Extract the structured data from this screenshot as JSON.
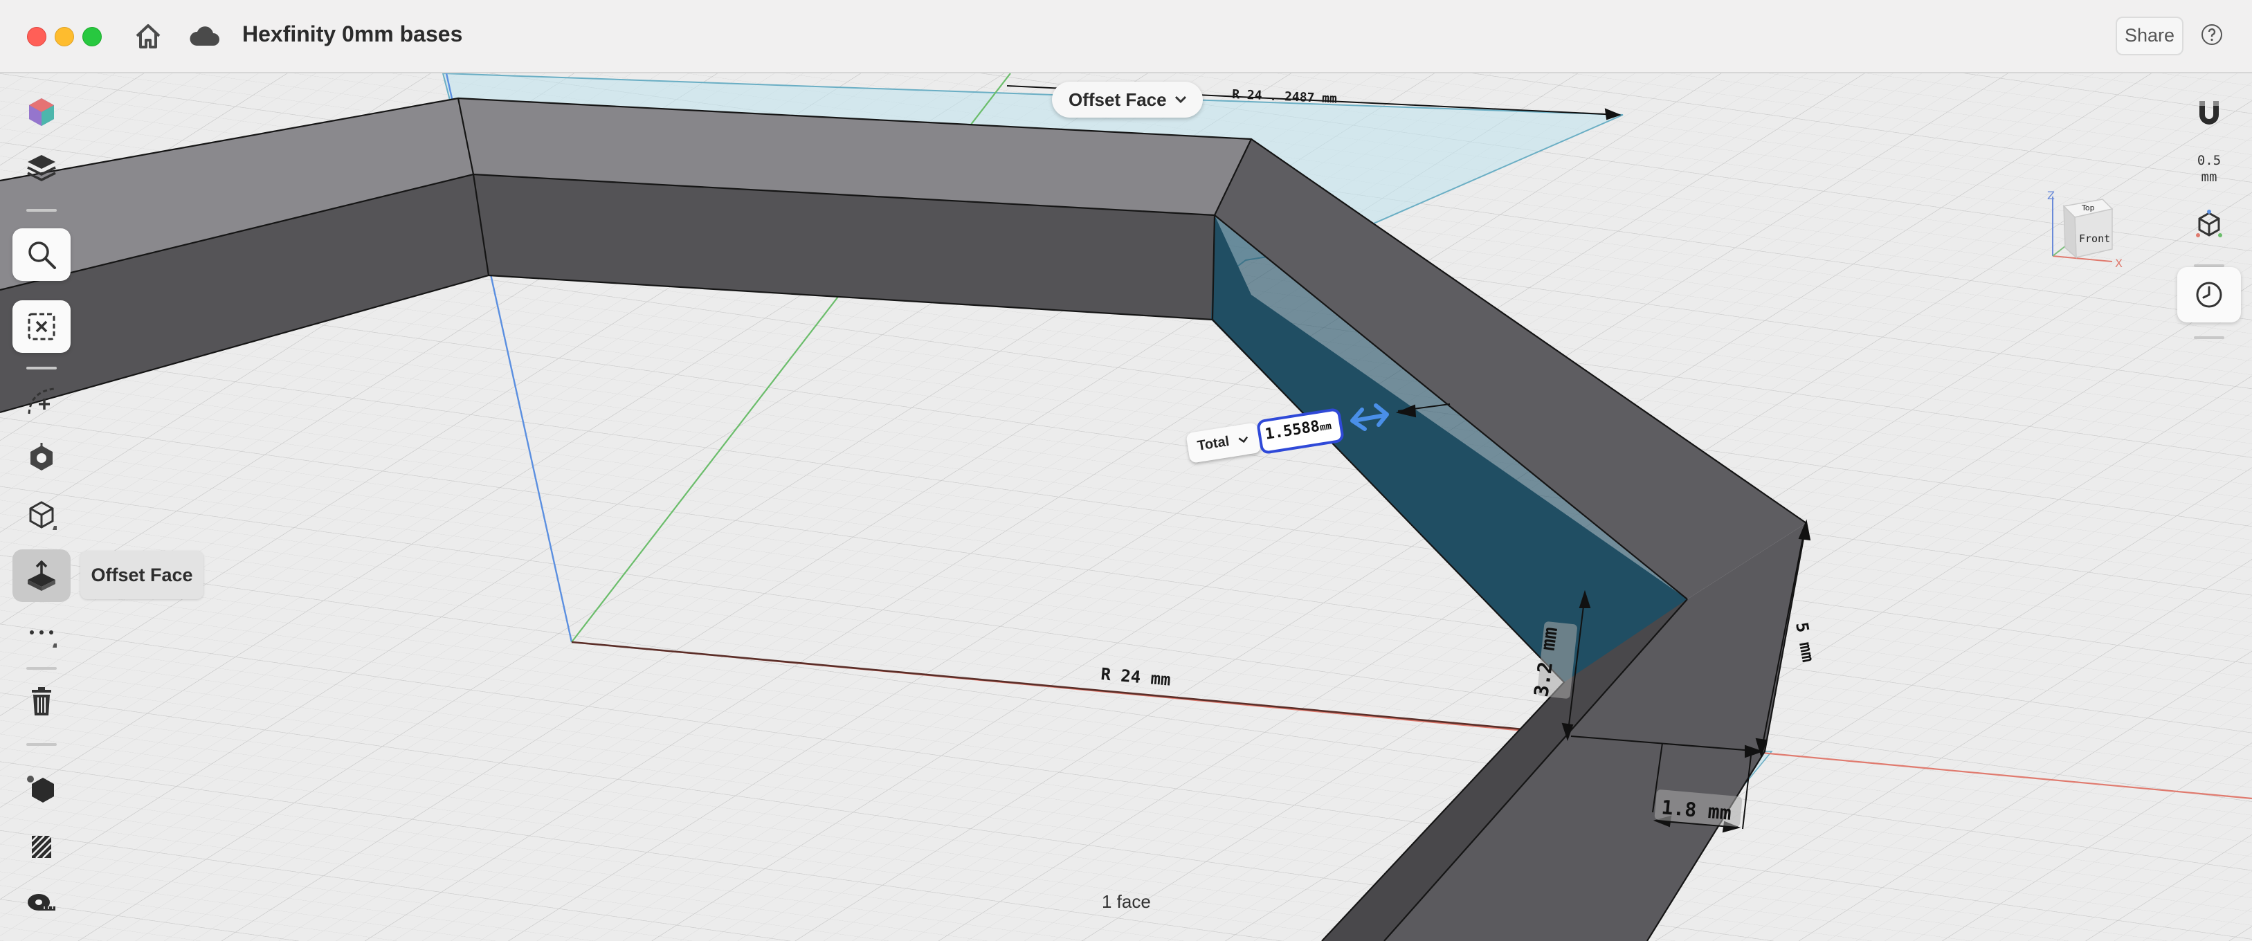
{
  "window": {
    "title": "Hexfinity 0mm bases",
    "share_label": "Share"
  },
  "titlebar_icons": [
    "home-icon",
    "cloud-icon",
    "help-icon"
  ],
  "command": {
    "label": "Offset Face"
  },
  "tooltip": {
    "label": "Offset Face"
  },
  "offset_input": {
    "mode": "Total",
    "value": "1.5588",
    "unit": "mm"
  },
  "dimensions": {
    "top_radius": "R 24 . 2487 mm",
    "radius": "R 24 mm",
    "height": "3.2 mm",
    "width": "1.8 mm",
    "side": "5 mm"
  },
  "view_cube": {
    "top": "Top",
    "front": "Front",
    "axis_x": "X",
    "axis_z": "Z"
  },
  "snap": {
    "value": "0.5",
    "unit": "mm"
  },
  "status": {
    "selection": "1 face"
  },
  "left_tools": [
    "appearance-icon",
    "layers-icon",
    "search-icon",
    "deselect-icon",
    "sketch-curve-icon",
    "transform-icon",
    "primitive-box-icon",
    "offset-face-icon",
    "more-icon",
    "delete-icon",
    "hexagon-shape-icon",
    "texture-icon",
    "measure-tape-icon"
  ],
  "right_tools": [
    "snap-magnet-icon",
    "axis-gizmo-icon",
    "history-clock-icon"
  ],
  "colors": {
    "selected_face": "#1f4e63",
    "highlight": "#2f49d8",
    "arrow": "#4a8fe8"
  }
}
